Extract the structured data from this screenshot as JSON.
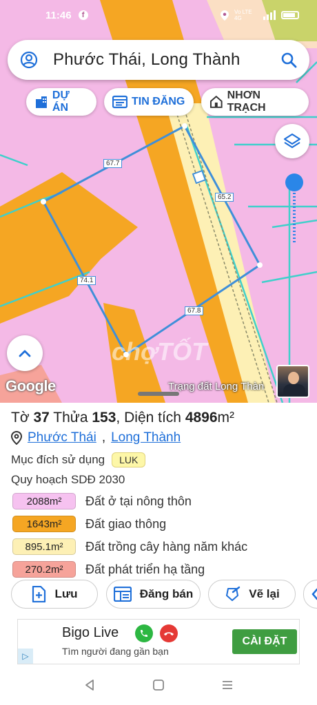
{
  "status_bar": {
    "time": "11:46",
    "network": "Vo LTE 4G"
  },
  "search": {
    "title": "Phước Thái, Long Thành"
  },
  "chips": [
    {
      "label": "DỰ ÁN"
    },
    {
      "label": "TIN ĐĂNG"
    },
    {
      "label": "NHƠN TRẠCH"
    }
  ],
  "map": {
    "edge_labels": [
      "67.7",
      "65.2",
      "74.1",
      "67.8"
    ],
    "google_logo": "Google",
    "watermark": "chợTỐT",
    "caption": "Trạng đất Long Thàn"
  },
  "parcel": {
    "to_label": "Tờ",
    "to_value": "37",
    "thua_label": "Thửa",
    "thua_value": "153",
    "area_label": "Diện tích",
    "area_value": "4896",
    "area_unit": "m²",
    "ward": "Phước Thái",
    "district": "Long Thành",
    "purpose_label": "Mục đích sử dụng",
    "purpose_code": "LUK",
    "plan_label": "Quy hoạch SDĐ 2030"
  },
  "legend": [
    {
      "area": "2088m²",
      "label": "Đất ở tại nông thôn",
      "color": "#f6c2f0"
    },
    {
      "area": "1643m²",
      "label": "Đất giao thông",
      "color": "#f5a623"
    },
    {
      "area": "895.1m²",
      "label": "Đất trồng cây hàng năm khác",
      "color": "#fdf0b5"
    },
    {
      "area": "270.2m²",
      "label": "Đất phát triển hạ tầng",
      "color": "#f6a39a"
    }
  ],
  "actions": {
    "save": "Lưu",
    "post": "Đăng bán",
    "redraw": "Vẽ lại"
  },
  "ad": {
    "title": "Bigo Live",
    "subtitle": "Tìm người đang gần bạn",
    "install": "CÀI ĐẶT"
  }
}
